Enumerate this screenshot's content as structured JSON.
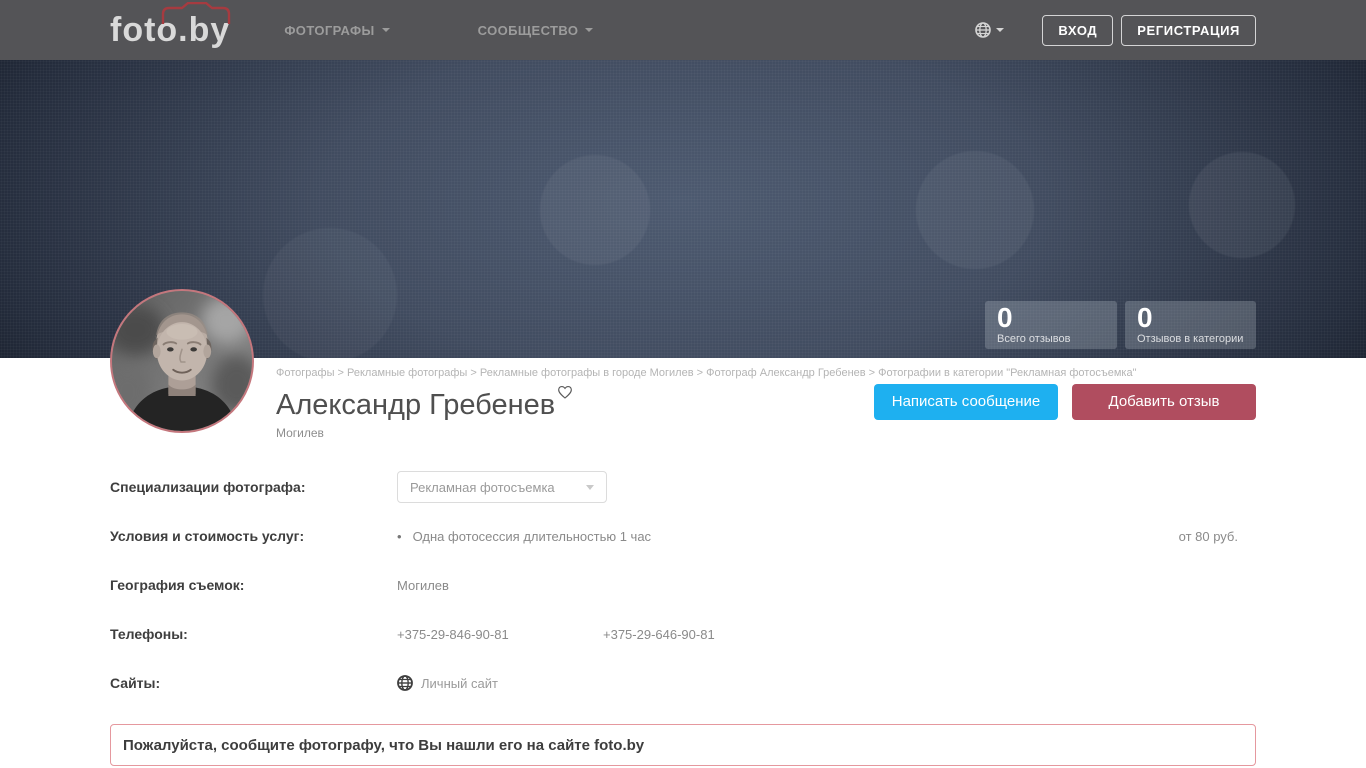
{
  "navbar": {
    "logo": "foto.by",
    "items": [
      {
        "label": "ФОТОГРАФЫ"
      },
      {
        "label": "СООБЩЕСТВО"
      }
    ],
    "login_label": "ВХОД",
    "register_label": "РЕГИСТРАЦИЯ"
  },
  "hero": {
    "stats": [
      {
        "value": "0",
        "label": "Всего отзывов"
      },
      {
        "value": "0",
        "label": "Отзывов в категории"
      }
    ]
  },
  "profile": {
    "breadcrumb": "Фотографы > Рекламные фотографы > Рекламные фотографы в городе Могилев > Фотограф Александр Гребенев > Фотографии в категории \"Рекламная фотосъемка\"",
    "name": "Александр Гребенев",
    "city": "Могилев",
    "message_button": "Написать сообщение",
    "review_button": "Добавить отзыв"
  },
  "details": {
    "specializations": {
      "label": "Специализации фотографа:",
      "selected": "Рекламная фотосъемка"
    },
    "pricing": {
      "label": "Условия и стоимость услуг:",
      "item": "Одна фотосессия длительностью 1 час",
      "price": "от 80 руб."
    },
    "geography": {
      "label": "География съемок:",
      "value": "Могилев"
    },
    "phones": {
      "label": "Телефоны:",
      "phone1": "+375-29-846-90-81",
      "phone2": "+375-29-646-90-81"
    },
    "sites": {
      "label": "Сайты:",
      "link": "Личный сайт"
    }
  },
  "notice": {
    "text": "Пожалуйста, сообщите фотографу, что Вы нашли его на сайте foto.by"
  },
  "colors": {
    "accent_blue": "#1eb0f0",
    "accent_red": "#b04d5f",
    "navbar_bg": "#545457",
    "hero_center": "#4d5a70",
    "hero_edge": "#11161f",
    "notice_border": "#e5989e"
  }
}
